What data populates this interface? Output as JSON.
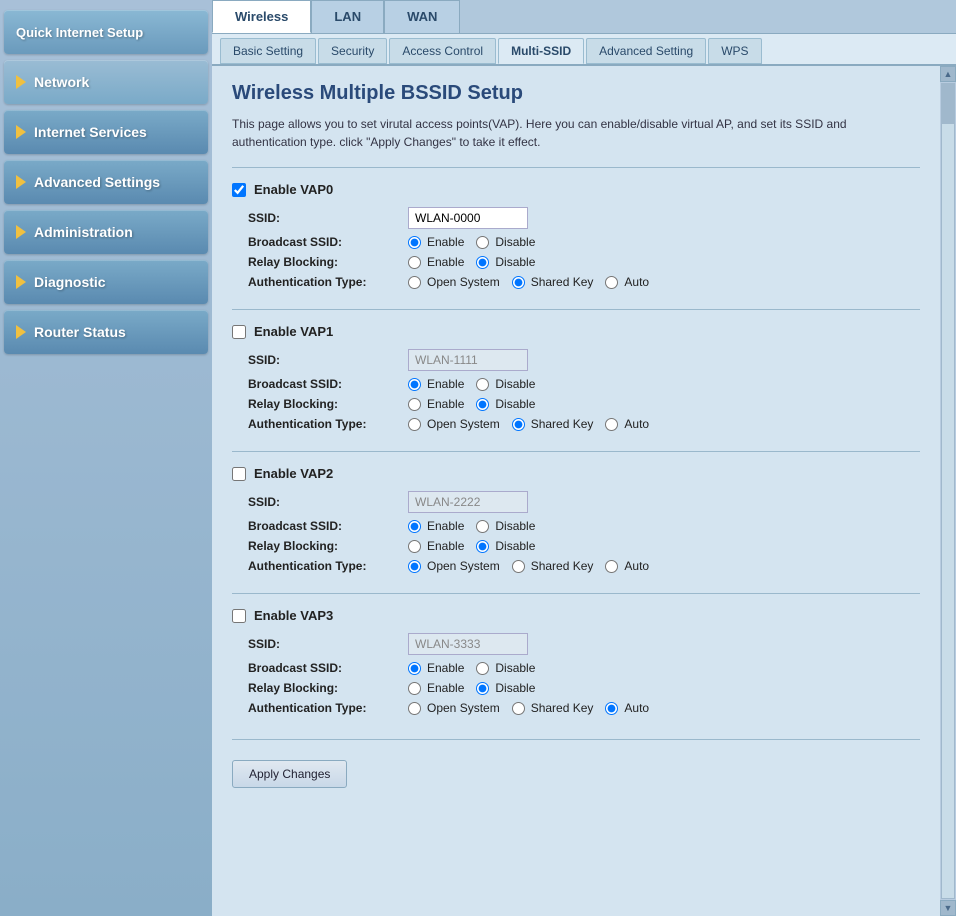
{
  "sidebar": {
    "items": [
      {
        "id": "quick-internet-setup",
        "label": "Quick Internet Setup",
        "arrow": false,
        "active": false
      },
      {
        "id": "network",
        "label": "Network",
        "arrow": true,
        "active": true
      },
      {
        "id": "internet-services",
        "label": "Internet Services",
        "arrow": true,
        "active": false
      },
      {
        "id": "advanced-settings",
        "label": "Advanced Settings",
        "arrow": true,
        "active": false
      },
      {
        "id": "administration",
        "label": "Administration",
        "arrow": true,
        "active": false
      },
      {
        "id": "diagnostic",
        "label": "Diagnostic",
        "arrow": true,
        "active": false
      },
      {
        "id": "router-status",
        "label": "Router Status",
        "arrow": true,
        "active": false
      }
    ]
  },
  "top_tabs": [
    {
      "id": "wireless",
      "label": "Wireless",
      "active": true
    },
    {
      "id": "lan",
      "label": "LAN",
      "active": false
    },
    {
      "id": "wan",
      "label": "WAN",
      "active": false
    }
  ],
  "sub_tabs": [
    {
      "id": "basic-setting",
      "label": "Basic Setting",
      "active": false
    },
    {
      "id": "security",
      "label": "Security",
      "active": false
    },
    {
      "id": "access-control",
      "label": "Access Control",
      "active": false
    },
    {
      "id": "multi-ssid",
      "label": "Multi-SSID",
      "active": true
    },
    {
      "id": "advanced-setting",
      "label": "Advanced Setting",
      "active": false
    },
    {
      "id": "wps",
      "label": "WPS",
      "active": false
    }
  ],
  "page": {
    "title": "Wireless Multiple BSSID Setup",
    "description": "This page allows you to set virutal access points(VAP). Here you can enable/disable virtual AP, and set its SSID and authentication type. click \"Apply Changes\" to take it effect."
  },
  "vaps": [
    {
      "id": "vap0",
      "enable_label": "Enable VAP0",
      "enabled": true,
      "ssid_label": "SSID:",
      "ssid_value": "WLAN-0000",
      "ssid_disabled": false,
      "broadcast_label": "Broadcast SSID:",
      "broadcast_enable": true,
      "relay_label": "Relay Blocking:",
      "relay_enable": false,
      "auth_label": "Authentication Type:",
      "auth_open": false,
      "auth_shared": true,
      "auth_auto": false
    },
    {
      "id": "vap1",
      "enable_label": "Enable VAP1",
      "enabled": false,
      "ssid_label": "SSID:",
      "ssid_value": "WLAN-1111",
      "ssid_disabled": true,
      "broadcast_label": "Broadcast SSID:",
      "broadcast_enable": true,
      "relay_label": "Relay Blocking:",
      "relay_enable": false,
      "auth_label": "Authentication Type:",
      "auth_open": false,
      "auth_shared": true,
      "auth_auto": false
    },
    {
      "id": "vap2",
      "enable_label": "Enable VAP2",
      "enabled": false,
      "ssid_label": "SSID:",
      "ssid_value": "WLAN-2222",
      "ssid_disabled": true,
      "broadcast_label": "Broadcast SSID:",
      "broadcast_enable": true,
      "relay_label": "Relay Blocking:",
      "relay_enable": false,
      "auth_label": "Authentication Type:",
      "auth_open": true,
      "auth_shared": false,
      "auth_auto": false
    },
    {
      "id": "vap3",
      "enable_label": "Enable VAP3",
      "enabled": false,
      "ssid_label": "SSID:",
      "ssid_value": "WLAN-3333",
      "ssid_disabled": true,
      "broadcast_label": "Broadcast SSID:",
      "broadcast_enable": true,
      "relay_label": "Relay Blocking:",
      "relay_enable": false,
      "auth_label": "Authentication Type:",
      "auth_open": false,
      "auth_shared": false,
      "auth_auto": true
    }
  ],
  "buttons": {
    "apply_changes": "Apply Changes"
  },
  "radio_labels": {
    "enable": "Enable",
    "disable": "Disable",
    "open_system": "Open System",
    "shared_key": "Shared Key",
    "auto": "Auto"
  }
}
